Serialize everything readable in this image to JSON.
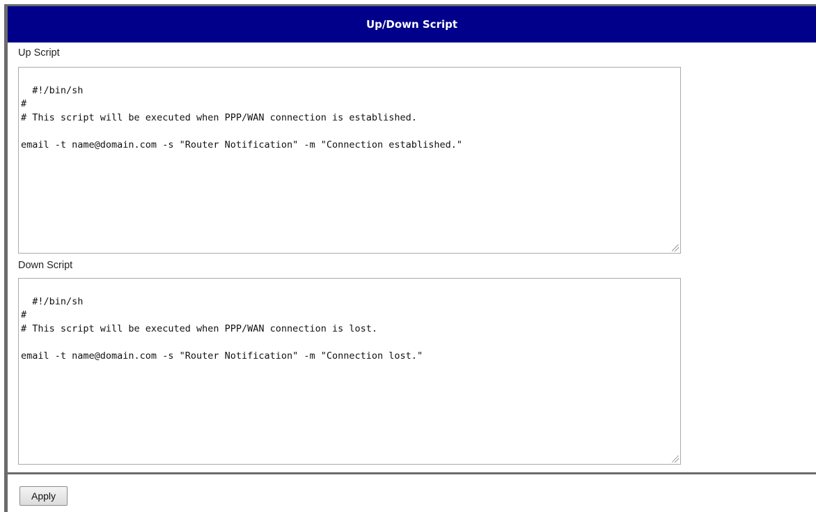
{
  "panel": {
    "title": "Up/Down Script"
  },
  "up_script": {
    "label": "Up Script",
    "content": "#!/bin/sh\n#\n# This script will be executed when PPP/WAN connection is established.\n\nemail -t name@domain.com -s \"Router Notification\" -m \"Connection established.\""
  },
  "down_script": {
    "label": "Down Script",
    "content": "#!/bin/sh\n#\n# This script will be executed when PPP/WAN connection is lost.\n\nemail -t name@domain.com -s \"Router Notification\" -m \"Connection lost.\""
  },
  "actions": {
    "apply_label": "Apply"
  },
  "colors": {
    "header_background": "#00008b",
    "header_text": "#ffffff",
    "frame_rule": "#6b6b6b"
  }
}
